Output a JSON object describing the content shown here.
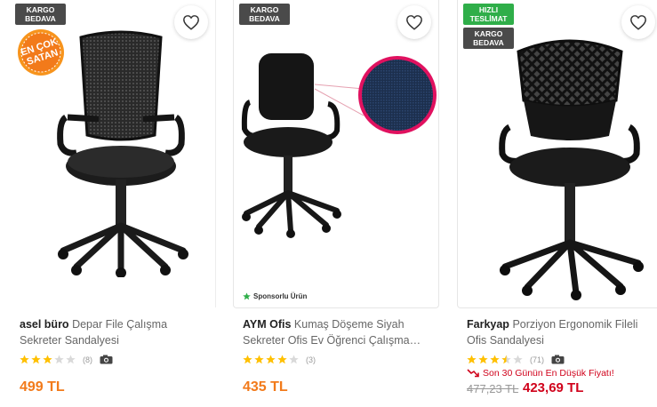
{
  "products": [
    {
      "badges": [
        "KARGO BEDAVA"
      ],
      "best_seller_text": [
        "EN ÇOK",
        "SATAN"
      ],
      "brand": "asel büro",
      "name": "Depar File Çalışma Sekreter Sandalyesi",
      "rating": 3,
      "review_count": "(8)",
      "price": "499 TL"
    },
    {
      "badges": [
        "KARGO BEDAVA"
      ],
      "sponsored": "Sponsorlu Ürün",
      "brand": "AYM Ofis",
      "name": "Kumaş Döşeme Siyah Sekreter Ofis Ev Öğrenci Çalışma Sandalyesi",
      "rating": 4,
      "review_count": "(3)",
      "price": "435 TL"
    },
    {
      "badges": [
        "HIZLI TESLİMAT",
        "KARGO BEDAVA"
      ],
      "brand": "Farkyap",
      "name": "Porziyon Ergonomik Fileli Ofis Sandalyesi",
      "rating": 3.5,
      "review_count": "(71)",
      "low_price_note": "Son 30 Günün En Düşük Fiyatı!",
      "old_price": "477,23 TL",
      "price": "423,69 TL"
    }
  ],
  "colors": {
    "accent": "#f27a1a",
    "discount": "#d0021b",
    "star": "#ffc000",
    "badge_dark": "#4a4a4a",
    "badge_green": "#2fae49"
  },
  "icons": {
    "favorite": "heart-outline-icon",
    "photo_review": "camera-icon",
    "sponsored": "star-icon",
    "trend": "trend-down-icon"
  }
}
